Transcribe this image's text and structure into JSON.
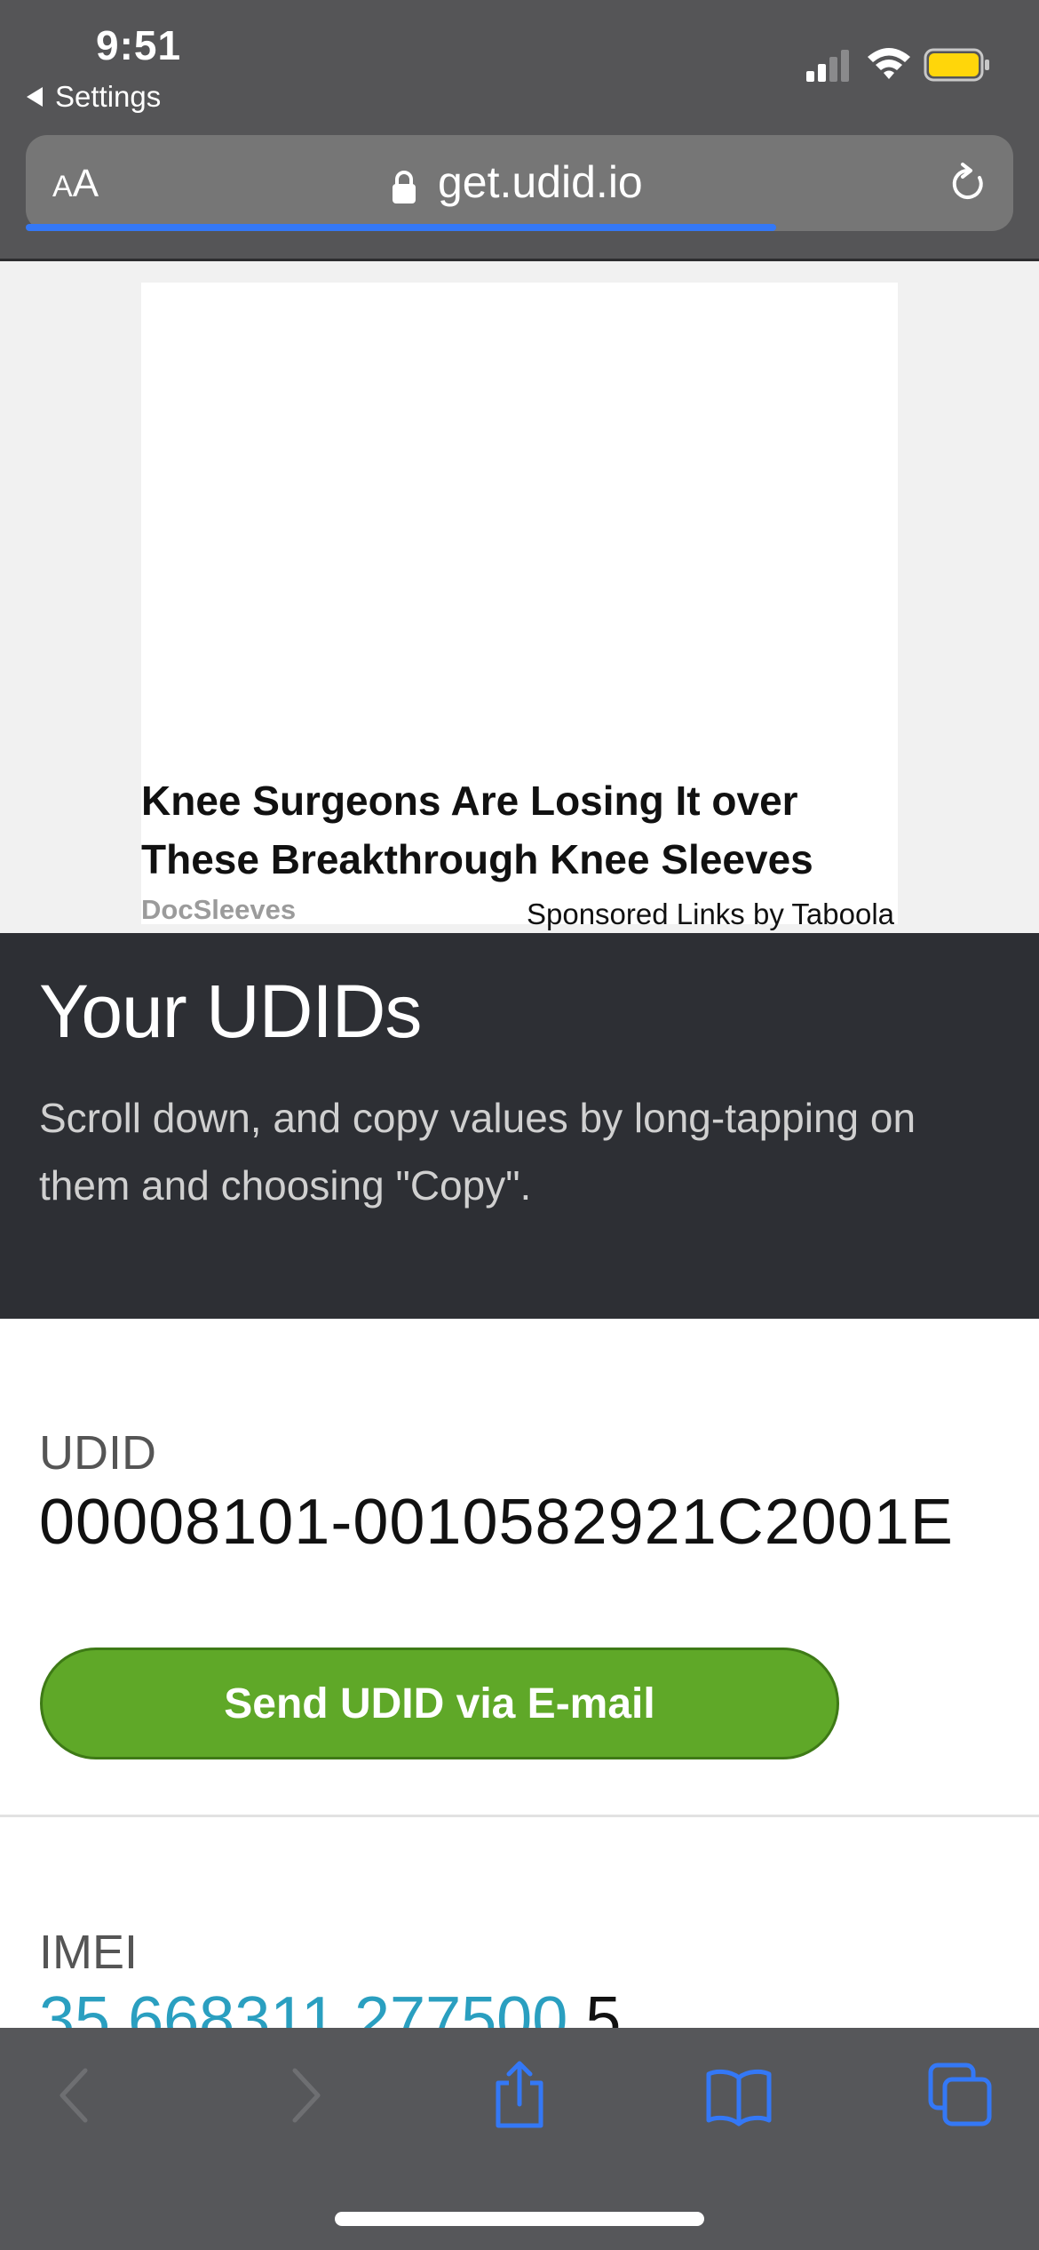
{
  "status_bar": {
    "time": "9:51",
    "back_label": "Settings"
  },
  "browser": {
    "text_size_small": "A",
    "text_size_big": "A",
    "url": "get.udid.io",
    "load_progress": 0.76,
    "accent_color": "#3478f6"
  },
  "ad": {
    "headline": "Knee Surgeons Are Losing It over These Breakthrough Knee Sleeves",
    "source": "DocSleeves",
    "sponsor": "Sponsored Links by Taboola"
  },
  "hero": {
    "title": "Your UDIDs",
    "subtitle": "Scroll down, and copy values by long-tapping on them and choosing \"Copy\"."
  },
  "udid": {
    "label": "UDID",
    "value": "00008101-0010582921C2001E",
    "send_button": "Send UDID via E-mail",
    "button_color": "#5fa828"
  },
  "imei": {
    "label": "IMEI",
    "value_link": "35 668311 277500",
    "value_tail": " 5"
  },
  "toolbar": {
    "icons": [
      "back-icon",
      "forward-icon",
      "share-icon",
      "bookmarks-icon",
      "tabs-icon"
    ]
  }
}
